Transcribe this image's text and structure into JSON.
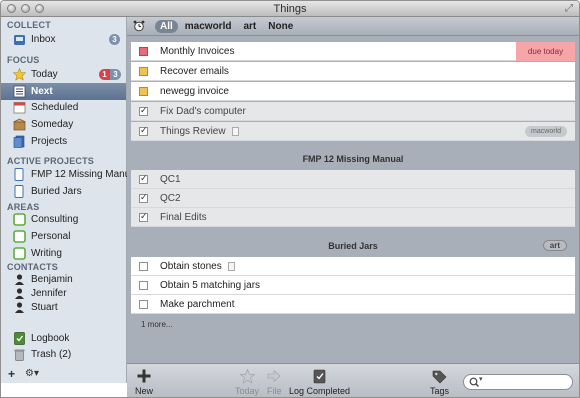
{
  "window": {
    "title": "Things"
  },
  "sidebar": {
    "collect_header": "COLLECT",
    "inbox": {
      "label": "Inbox",
      "badge": "3"
    },
    "focus_header": "FOCUS",
    "today": {
      "label": "Today",
      "badge_red": "1",
      "badge_gray": "3"
    },
    "next": {
      "label": "Next"
    },
    "scheduled": {
      "label": "Scheduled"
    },
    "someday": {
      "label": "Someday"
    },
    "projects": {
      "label": "Projects"
    },
    "active_projects_header": "ACTIVE PROJECTS",
    "active_projects": [
      "FMP 12 Missing Manual",
      "Buried Jars"
    ],
    "areas_header": "AREAS",
    "areas": [
      "Consulting",
      "Personal",
      "Writing"
    ],
    "contacts_header": "CONTACTS",
    "contacts": [
      "Benjamin",
      "Jennifer",
      "Stuart"
    ],
    "logbook": {
      "label": "Logbook"
    },
    "trash": {
      "label": "Trash (2)"
    },
    "add_label": "+",
    "gear_label": "⚙▾"
  },
  "filterbar": {
    "tags": [
      "All",
      "macworld",
      "art",
      "None"
    ],
    "selected": "All"
  },
  "main": {
    "tasks": [
      {
        "label": "Monthly Invoices",
        "due": "due today",
        "color": "#e86a77"
      },
      {
        "label": "Recover emails",
        "color": "#f2c14f"
      },
      {
        "label": "newegg invoice",
        "color": "#f2c14f"
      },
      {
        "label": "Fix Dad's computer",
        "checked": true
      },
      {
        "label": "Things Review",
        "checked": true,
        "tag": "macworld"
      }
    ],
    "group1": {
      "title": "FMP 12 Missing Manual",
      "tasks": [
        "QC1",
        "QC2",
        "Final Edits"
      ]
    },
    "group2": {
      "title": "Buried Jars",
      "tag": "art",
      "tasks": [
        "Obtain stones",
        "Obtain 5 matching jars",
        "Make parchment"
      ]
    },
    "more": "1 more..."
  },
  "bottombar": {
    "new": "New",
    "today": "Today",
    "file": "File",
    "log_completed": "Log Completed",
    "tags": "Tags",
    "search_placeholder": ""
  }
}
